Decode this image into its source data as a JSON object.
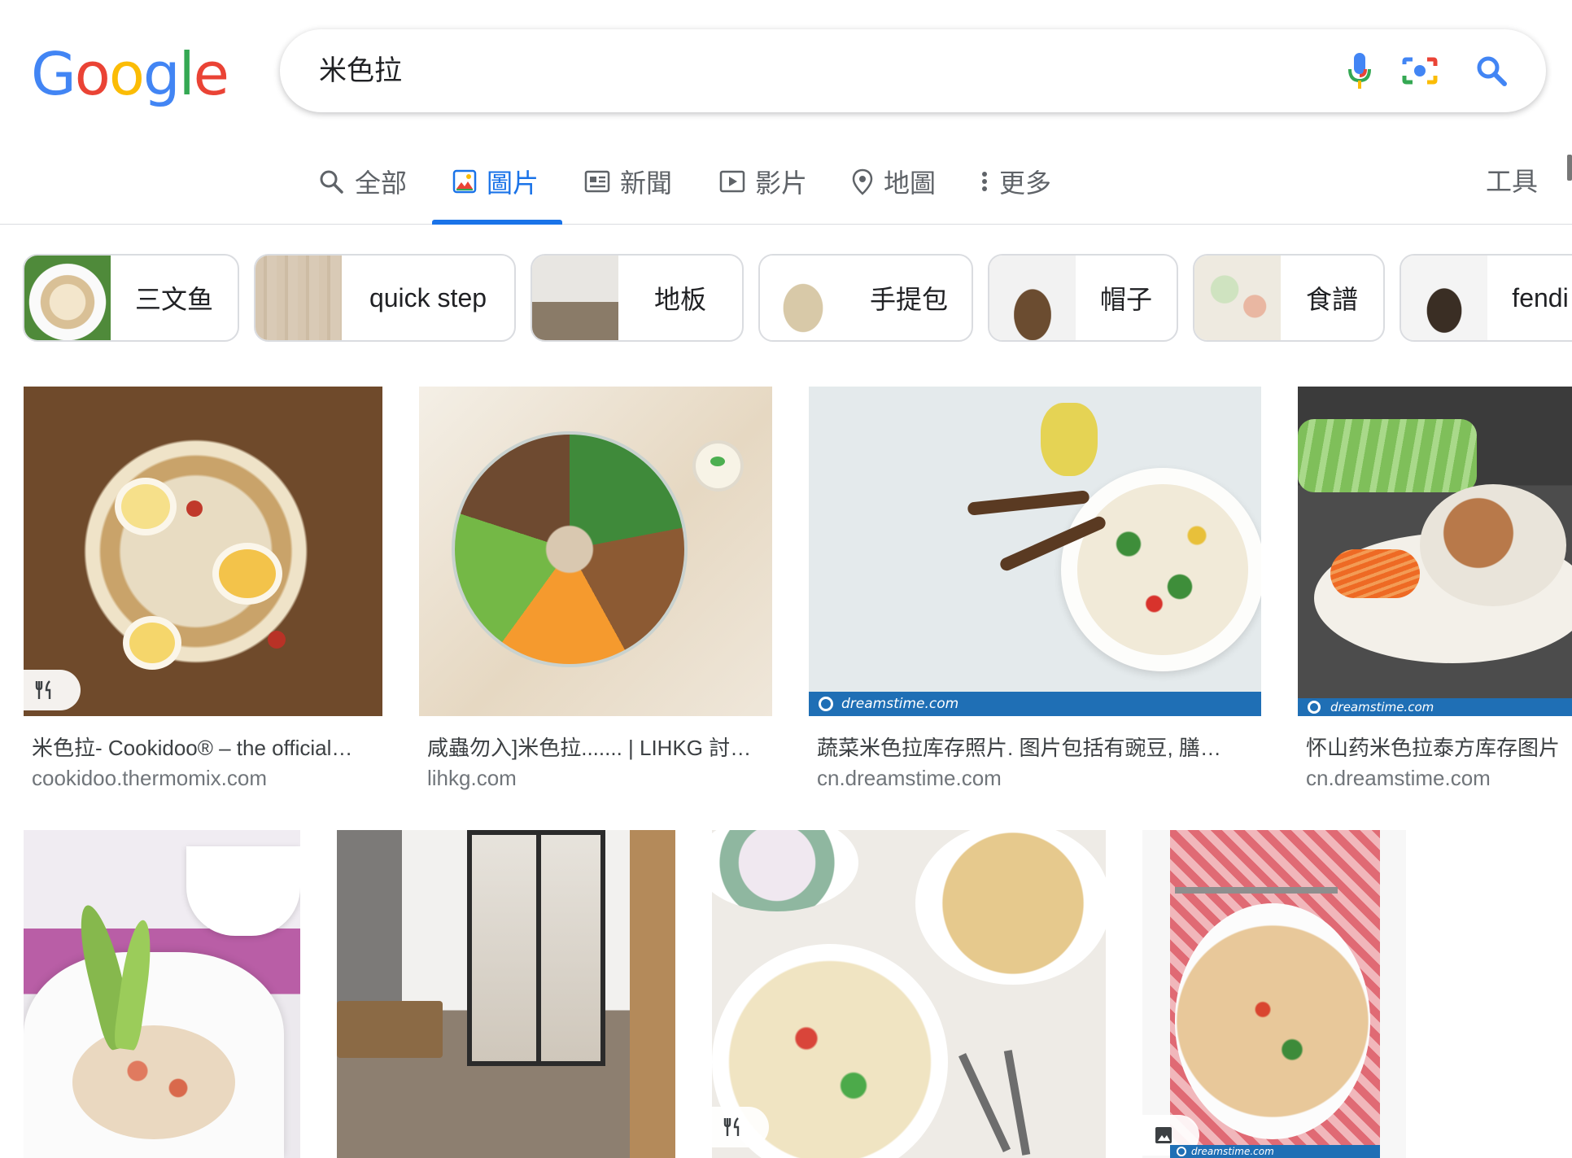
{
  "logo": {
    "letters": [
      "G",
      "o",
      "o",
      "g",
      "l",
      "e"
    ],
    "colors": [
      "#4285F4",
      "#EA4335",
      "#FBBC05",
      "#4285F4",
      "#34A853",
      "#EA4335"
    ]
  },
  "search": {
    "query": "米色拉",
    "icons": [
      "mic-icon",
      "camera-icon",
      "search-icon"
    ]
  },
  "tabs": [
    {
      "label": "全部",
      "icon": "search-icon"
    },
    {
      "label": "圖片",
      "icon": "image-icon",
      "active": true
    },
    {
      "label": "新聞",
      "icon": "news-icon"
    },
    {
      "label": "影片",
      "icon": "video-icon"
    },
    {
      "label": "地圖",
      "icon": "map-pin-icon"
    },
    {
      "label": "更多",
      "icon": "more-vert-icon"
    }
  ],
  "tools_label": "工具",
  "chips": [
    {
      "label": "三文鱼"
    },
    {
      "label": "quick step"
    },
    {
      "label": "地板"
    },
    {
      "label": "手提包"
    },
    {
      "label": "帽子"
    },
    {
      "label": "食譜"
    },
    {
      "label": "fendi"
    }
  ],
  "results": [
    {
      "title": "米色拉- Cookidoo® – the official…",
      "site": "cookidoo.thermomix.com",
      "badge": "recipe-icon"
    },
    {
      "title": "咸蟲勿入]米色拉....... | LIHKG 討…",
      "site": "lihkg.com"
    },
    {
      "title": "蔬菜米色拉库存照片. 图片包括有豌豆, 膳…",
      "site": "cn.dreamstime.com",
      "watermark": "dreamstime.com"
    },
    {
      "title": "怀山药米色拉泰方库存图片",
      "site": "cn.dreamstime.com",
      "watermark": "dreamstime.com"
    },
    {},
    {},
    {
      "badge": "recipe-icon"
    },
    {
      "badge": "image-icon",
      "watermark": "dreamstime.com"
    }
  ],
  "colors": {
    "accent": "#1a73e8",
    "text": "#202124",
    "muted": "#70757a",
    "border": "#dadce0"
  }
}
